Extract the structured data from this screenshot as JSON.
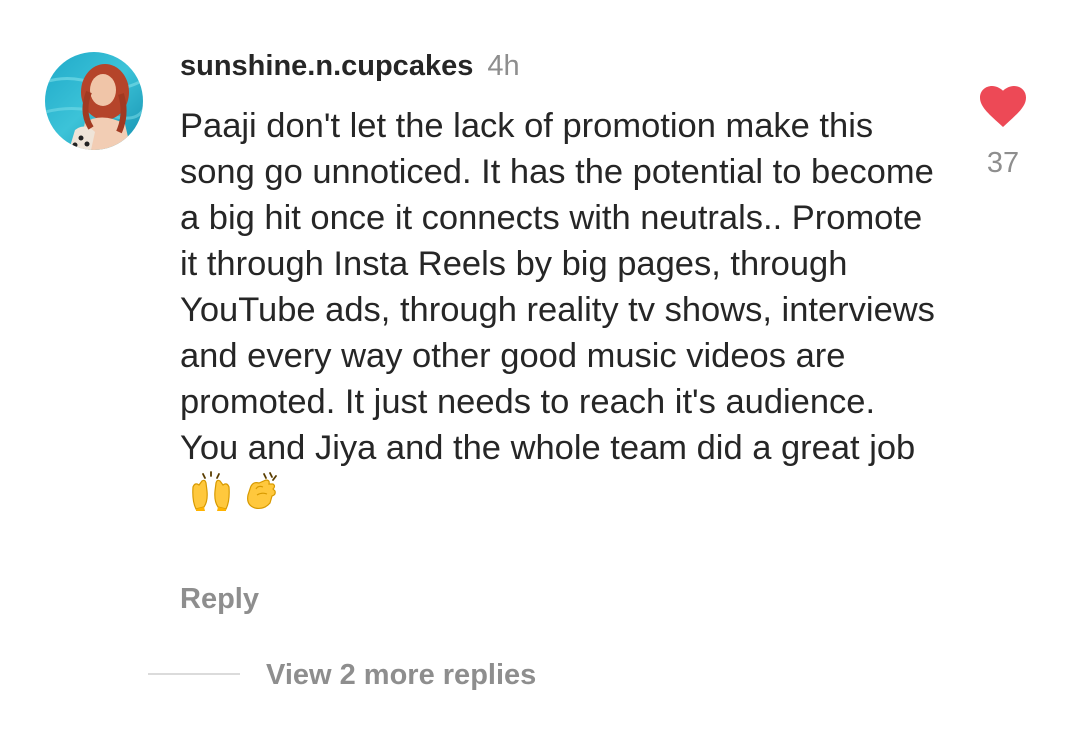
{
  "comment": {
    "avatar_icon": "profile-photo-avatar",
    "username": "sunshine.n.cupcakes",
    "time": "4h",
    "text": "Paaji don't let the lack of promotion make this song go unnoticed. It has the potential to become a big hit once it connects with neutrals.. Promote it through Insta Reels by big pages, through YouTube ads, through reality tv shows, interviews and every way other good music videos are promoted. It just needs to reach it's audience. You and Jiya and the whole team did a great job",
    "emojis": [
      "raising-hands-emoji",
      "clapping-hands-emoji"
    ],
    "reply_label": "Reply",
    "like": {
      "icon": "heart-icon",
      "liked": true,
      "count": "37",
      "color": "#ed4956"
    },
    "view_replies_label": "View 2 more replies"
  }
}
